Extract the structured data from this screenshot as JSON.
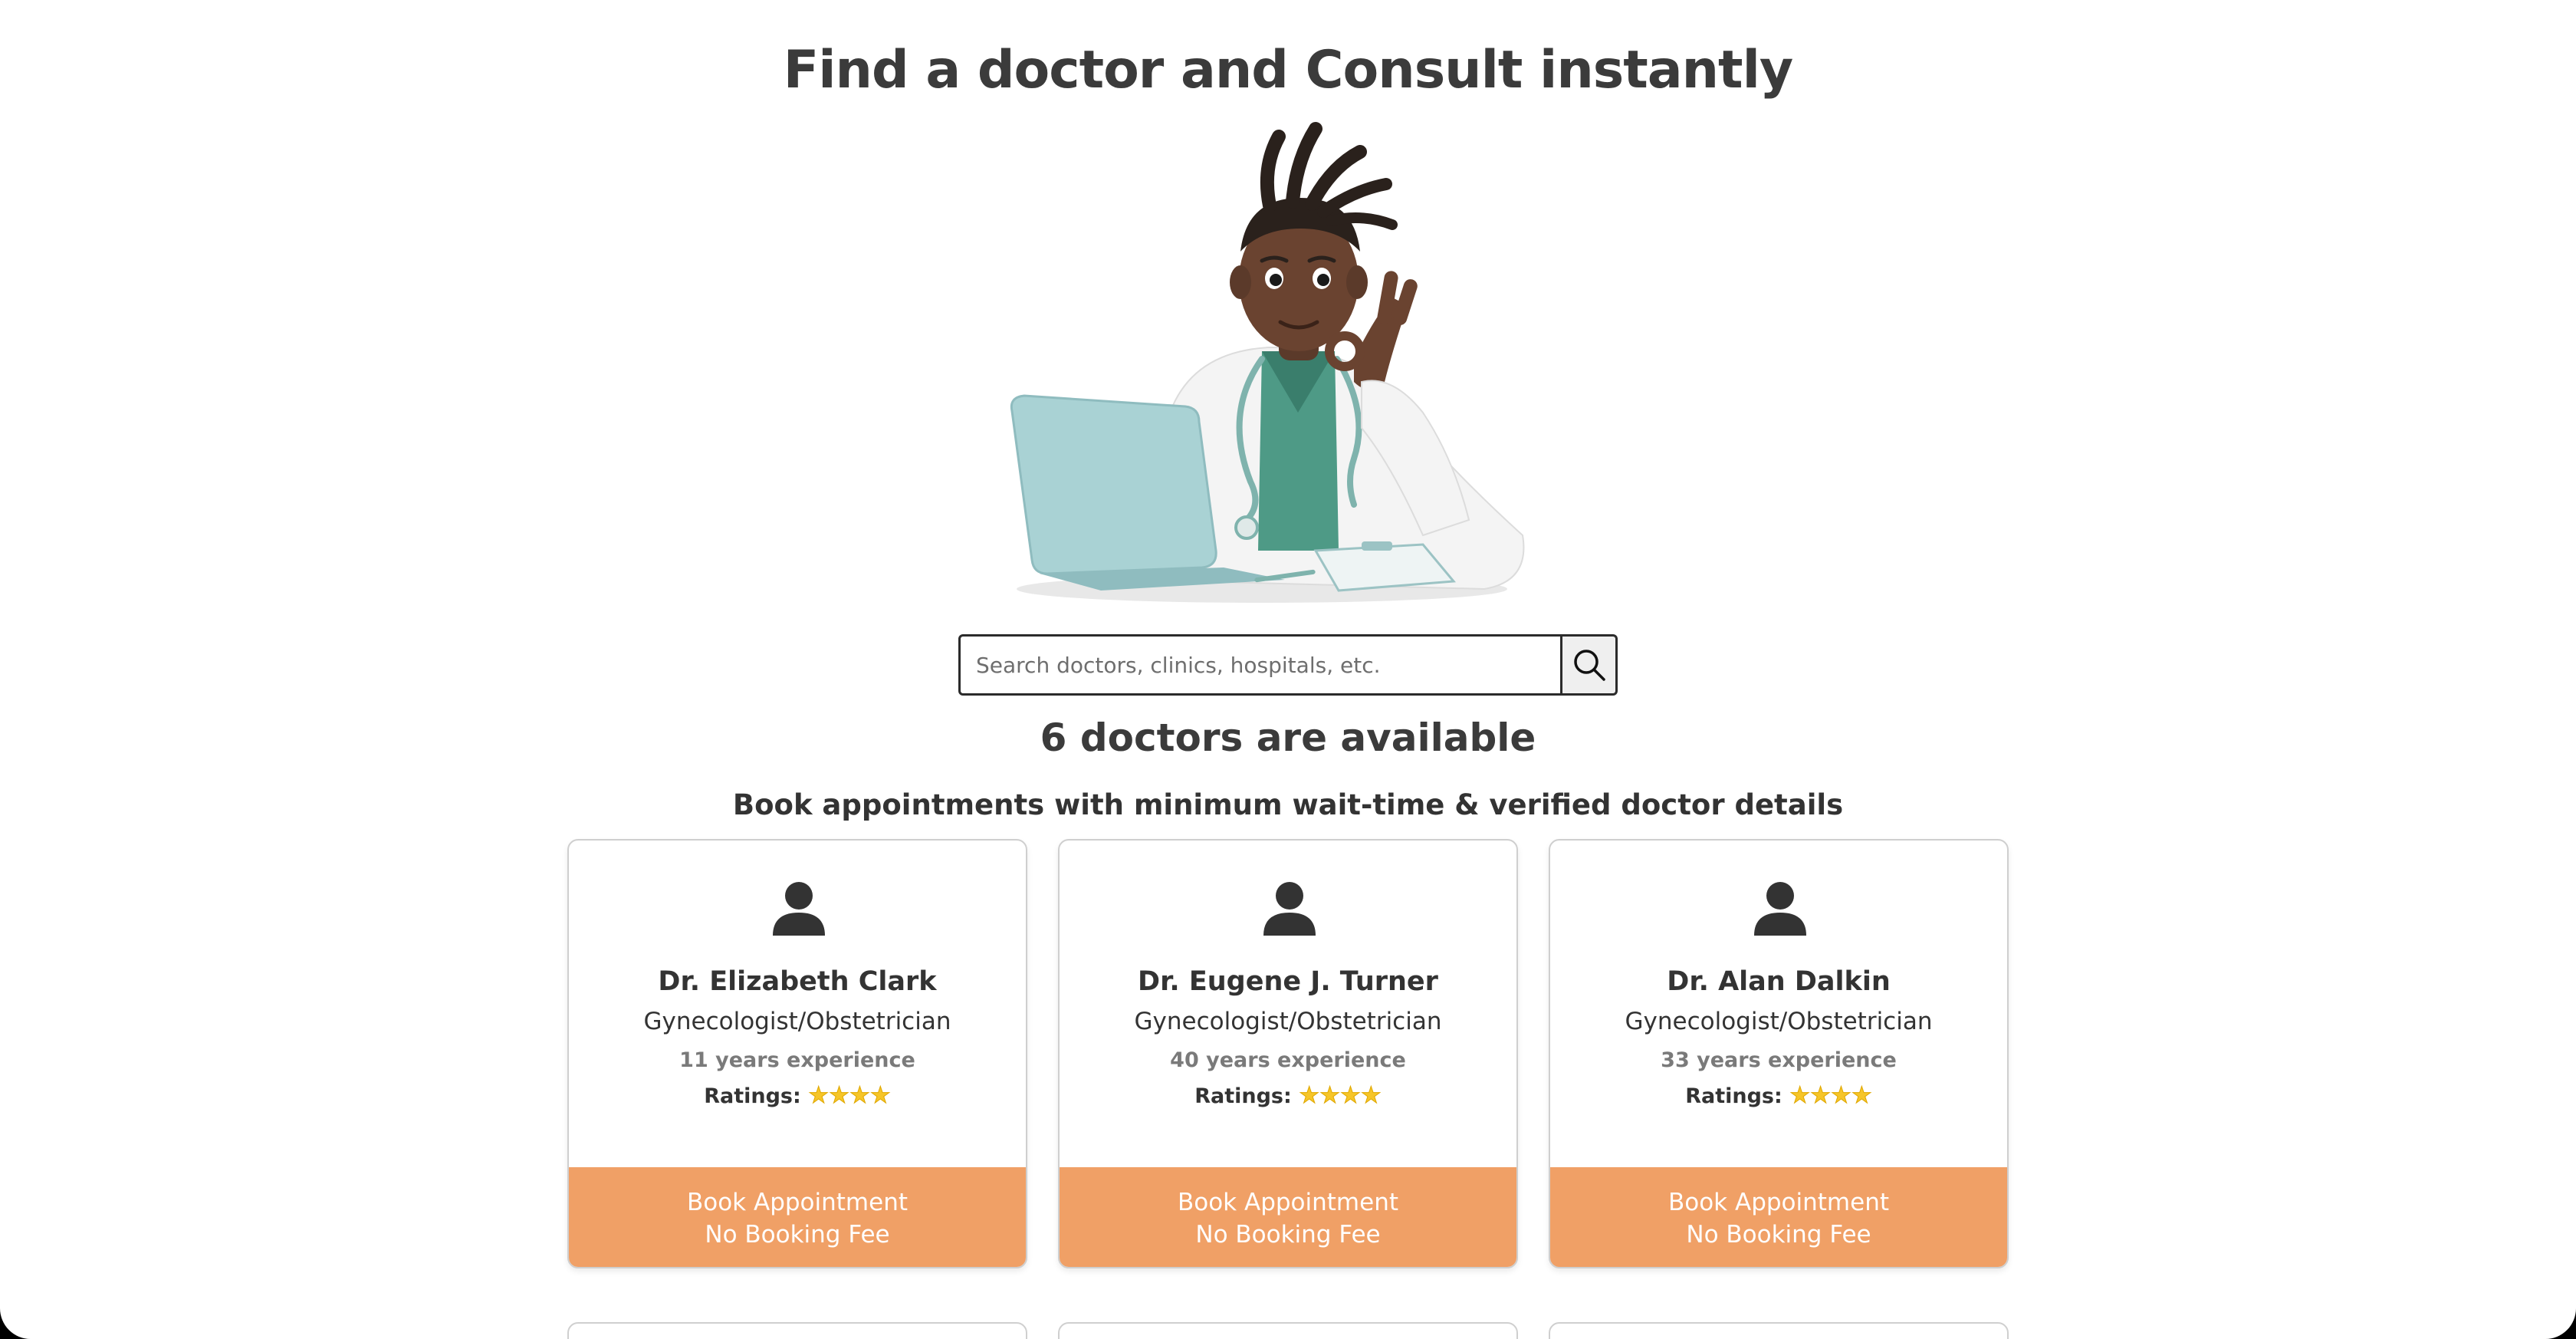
{
  "header": {
    "title": "Find a doctor and Consult instantly"
  },
  "search": {
    "placeholder": "Search doctors, clinics, hospitals, etc.",
    "button_icon": "search-icon"
  },
  "results": {
    "count_text": "6 doctors are available",
    "subtitle": "Book appointments with minimum wait-time & verified doctor details"
  },
  "doctors": [
    {
      "name": "Dr. Elizabeth Clark",
      "specialty": "Gynecologist/Obstetrician",
      "experience": "11 years experience",
      "ratings_label": "Ratings:",
      "stars": 4,
      "stars_text": "★★★★",
      "button_line1": "Book Appointment",
      "button_line2": "No Booking Fee"
    },
    {
      "name": "Dr. Eugene J. Turner",
      "specialty": "Gynecologist/Obstetrician",
      "experience": "40 years experience",
      "ratings_label": "Ratings:",
      "stars": 4,
      "stars_text": "★★★★",
      "button_line1": "Book Appointment",
      "button_line2": "No Booking Fee"
    },
    {
      "name": "Dr. Alan Dalkin",
      "specialty": "Gynecologist/Obstetrician",
      "experience": "33 years experience",
      "ratings_label": "Ratings:",
      "stars": 4,
      "stars_text": "★★★★",
      "button_line1": "Book Appointment",
      "button_line2": "No Booking Fee"
    }
  ],
  "colors": {
    "accent": "#f0a066",
    "heading": "#3b3b3b",
    "star": "#f6c528",
    "card_border": "#cfcfcf",
    "scrub_green": "#4e9a86",
    "laptop": "#a9d2d4"
  }
}
